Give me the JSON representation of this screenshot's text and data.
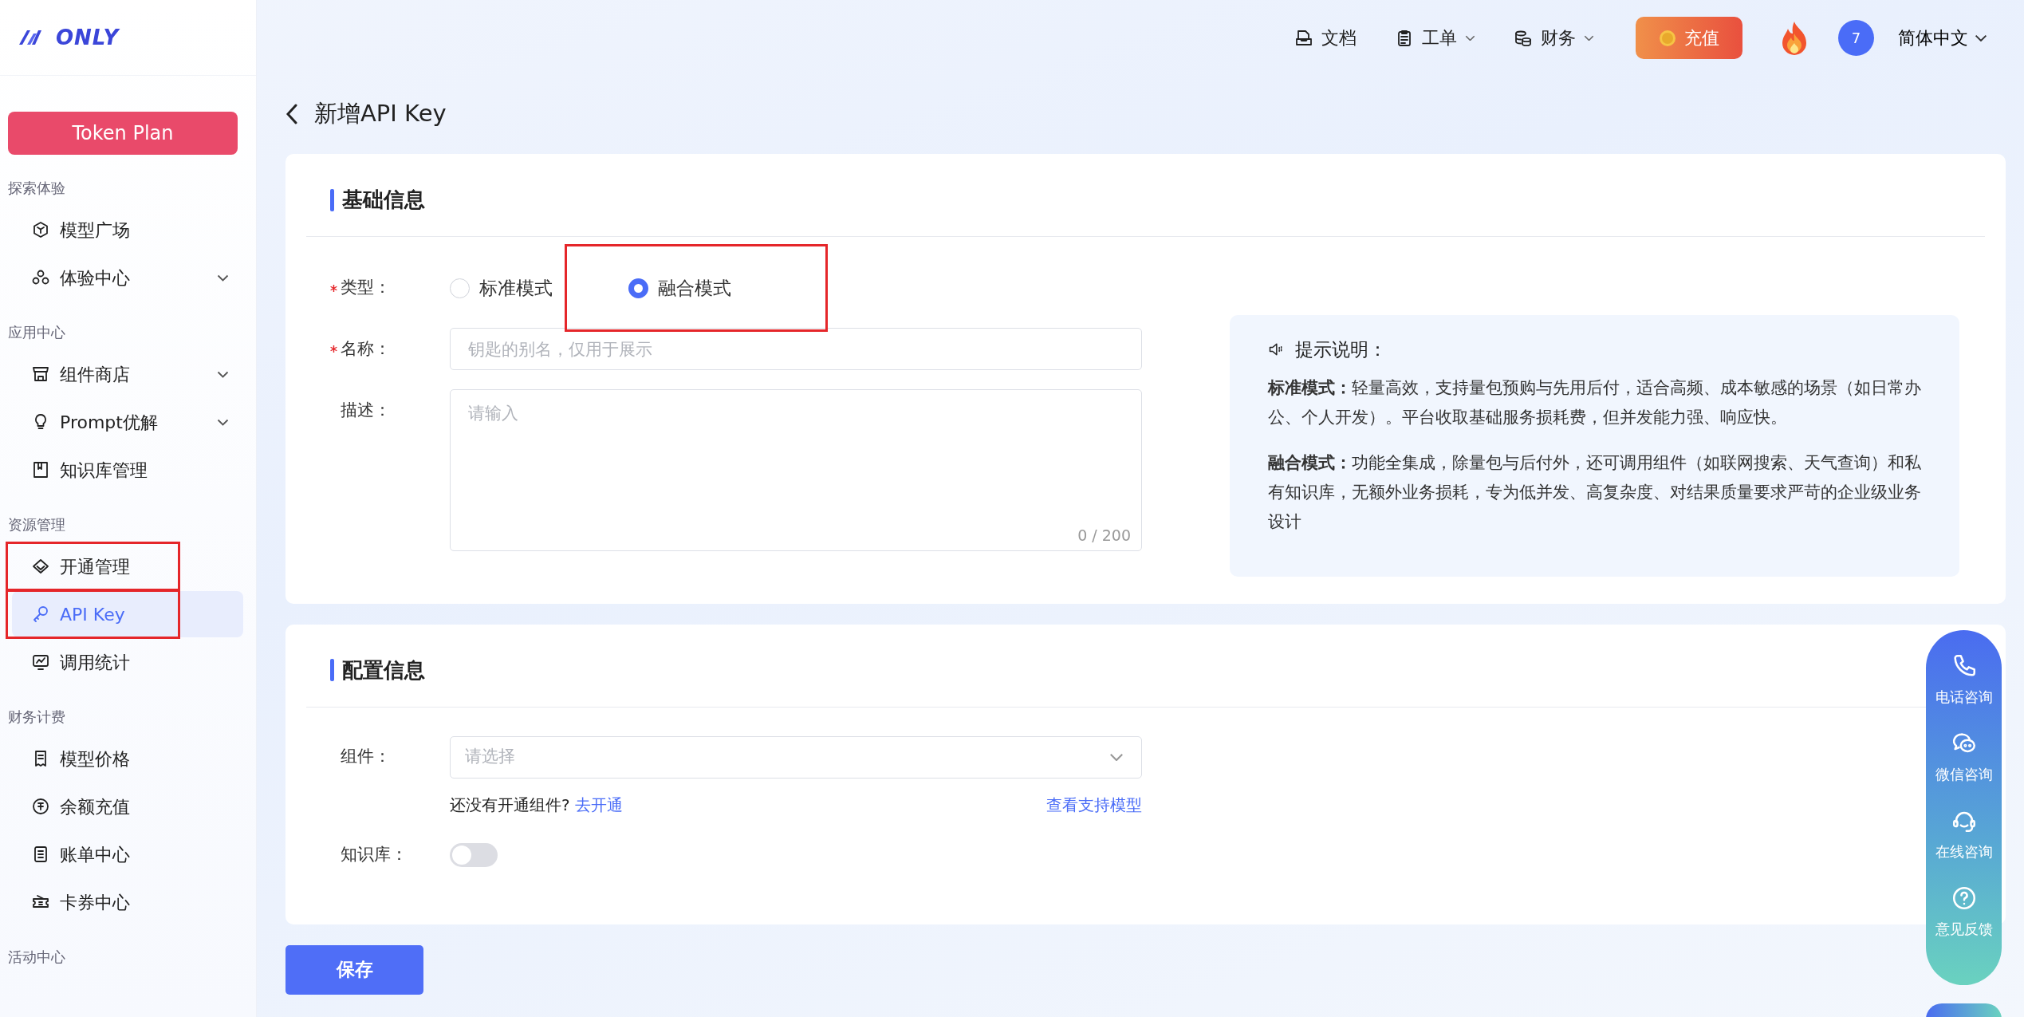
{
  "header": {
    "logo_text": "ONLY",
    "nav": [
      {
        "label": "文档",
        "dropdown": false
      },
      {
        "label": "工单",
        "dropdown": true
      },
      {
        "label": "财务",
        "dropdown": true
      }
    ],
    "recharge": "充值",
    "avatar": "7",
    "language": "简体中文"
  },
  "sidebar": {
    "promo": "Token Plan",
    "sections": [
      {
        "title": "探索体验",
        "items": [
          {
            "label": "模型广场",
            "expandable": false,
            "selected": false,
            "highlighted": false
          },
          {
            "label": "体验中心",
            "expandable": true,
            "selected": false,
            "highlighted": false
          }
        ]
      },
      {
        "title": "应用中心",
        "items": [
          {
            "label": "组件商店",
            "expandable": true,
            "selected": false,
            "highlighted": false
          },
          {
            "label": "Prompt优解",
            "expandable": true,
            "selected": false,
            "highlighted": false
          },
          {
            "label": "知识库管理",
            "expandable": false,
            "selected": false,
            "highlighted": false
          }
        ]
      },
      {
        "title": "资源管理",
        "items": [
          {
            "label": "开通管理",
            "expandable": false,
            "selected": false,
            "highlighted": true
          },
          {
            "label": "API Key",
            "expandable": false,
            "selected": true,
            "highlighted": true
          },
          {
            "label": "调用统计",
            "expandable": false,
            "selected": false,
            "highlighted": false
          }
        ]
      },
      {
        "title": "财务计费",
        "items": [
          {
            "label": "模型价格",
            "expandable": false,
            "selected": false,
            "highlighted": false
          },
          {
            "label": "余额充值",
            "expandable": false,
            "selected": false,
            "highlighted": false
          },
          {
            "label": "账单中心",
            "expandable": false,
            "selected": false,
            "highlighted": false
          },
          {
            "label": "卡券中心",
            "expandable": false,
            "selected": false,
            "highlighted": false
          }
        ]
      },
      {
        "title": "活动中心"
      }
    ]
  },
  "page": {
    "title": "新增API Key",
    "basic": {
      "title": "基础信息",
      "type_field": {
        "label": "类型：",
        "required": true,
        "options": [
          {
            "label": "标准模式",
            "selected": false,
            "highlighted": false
          },
          {
            "label": "融合模式",
            "selected": true,
            "highlighted": true
          }
        ]
      },
      "name_field": {
        "label": "名称：",
        "required": true,
        "placeholder": "钥匙的别名，仅用于展示"
      },
      "desc_field": {
        "label": "描述：",
        "required": false,
        "placeholder": "请输入",
        "counter": "0 / 200"
      },
      "tips": {
        "title": "提示说明：",
        "paragraphs": [
          "**标准模式：**轻量高效，支持量包预购与先用后付，适合高频、成本敏感的场景（如日常办公、个人开发）。平台收取基础服务损耗费，但并发能力强、响应快。",
          "**融合模式：**功能全集成，除量包与后付外，还可调用组件（如联网搜索、天气查询）和私有知识库，无额外业务损耗，专为低并发、高复杂度、对结果质量要求严苛的企业级业务设计"
        ]
      }
    },
    "config": {
      "title": "配置信息",
      "component_field": {
        "label": "组件：",
        "placeholder": "请选择",
        "hint": "还没有开通组件?",
        "hint_link": "去开通",
        "side_link": "查看支持模型"
      },
      "knowledge_field": {
        "label": "知识库：",
        "on": false
      }
    },
    "save": "保存"
  },
  "float_panel": {
    "items": [
      {
        "label": "电话咨询"
      },
      {
        "label": "微信咨询"
      },
      {
        "label": "在线咨询"
      },
      {
        "label": "意见反馈"
      }
    ]
  }
}
